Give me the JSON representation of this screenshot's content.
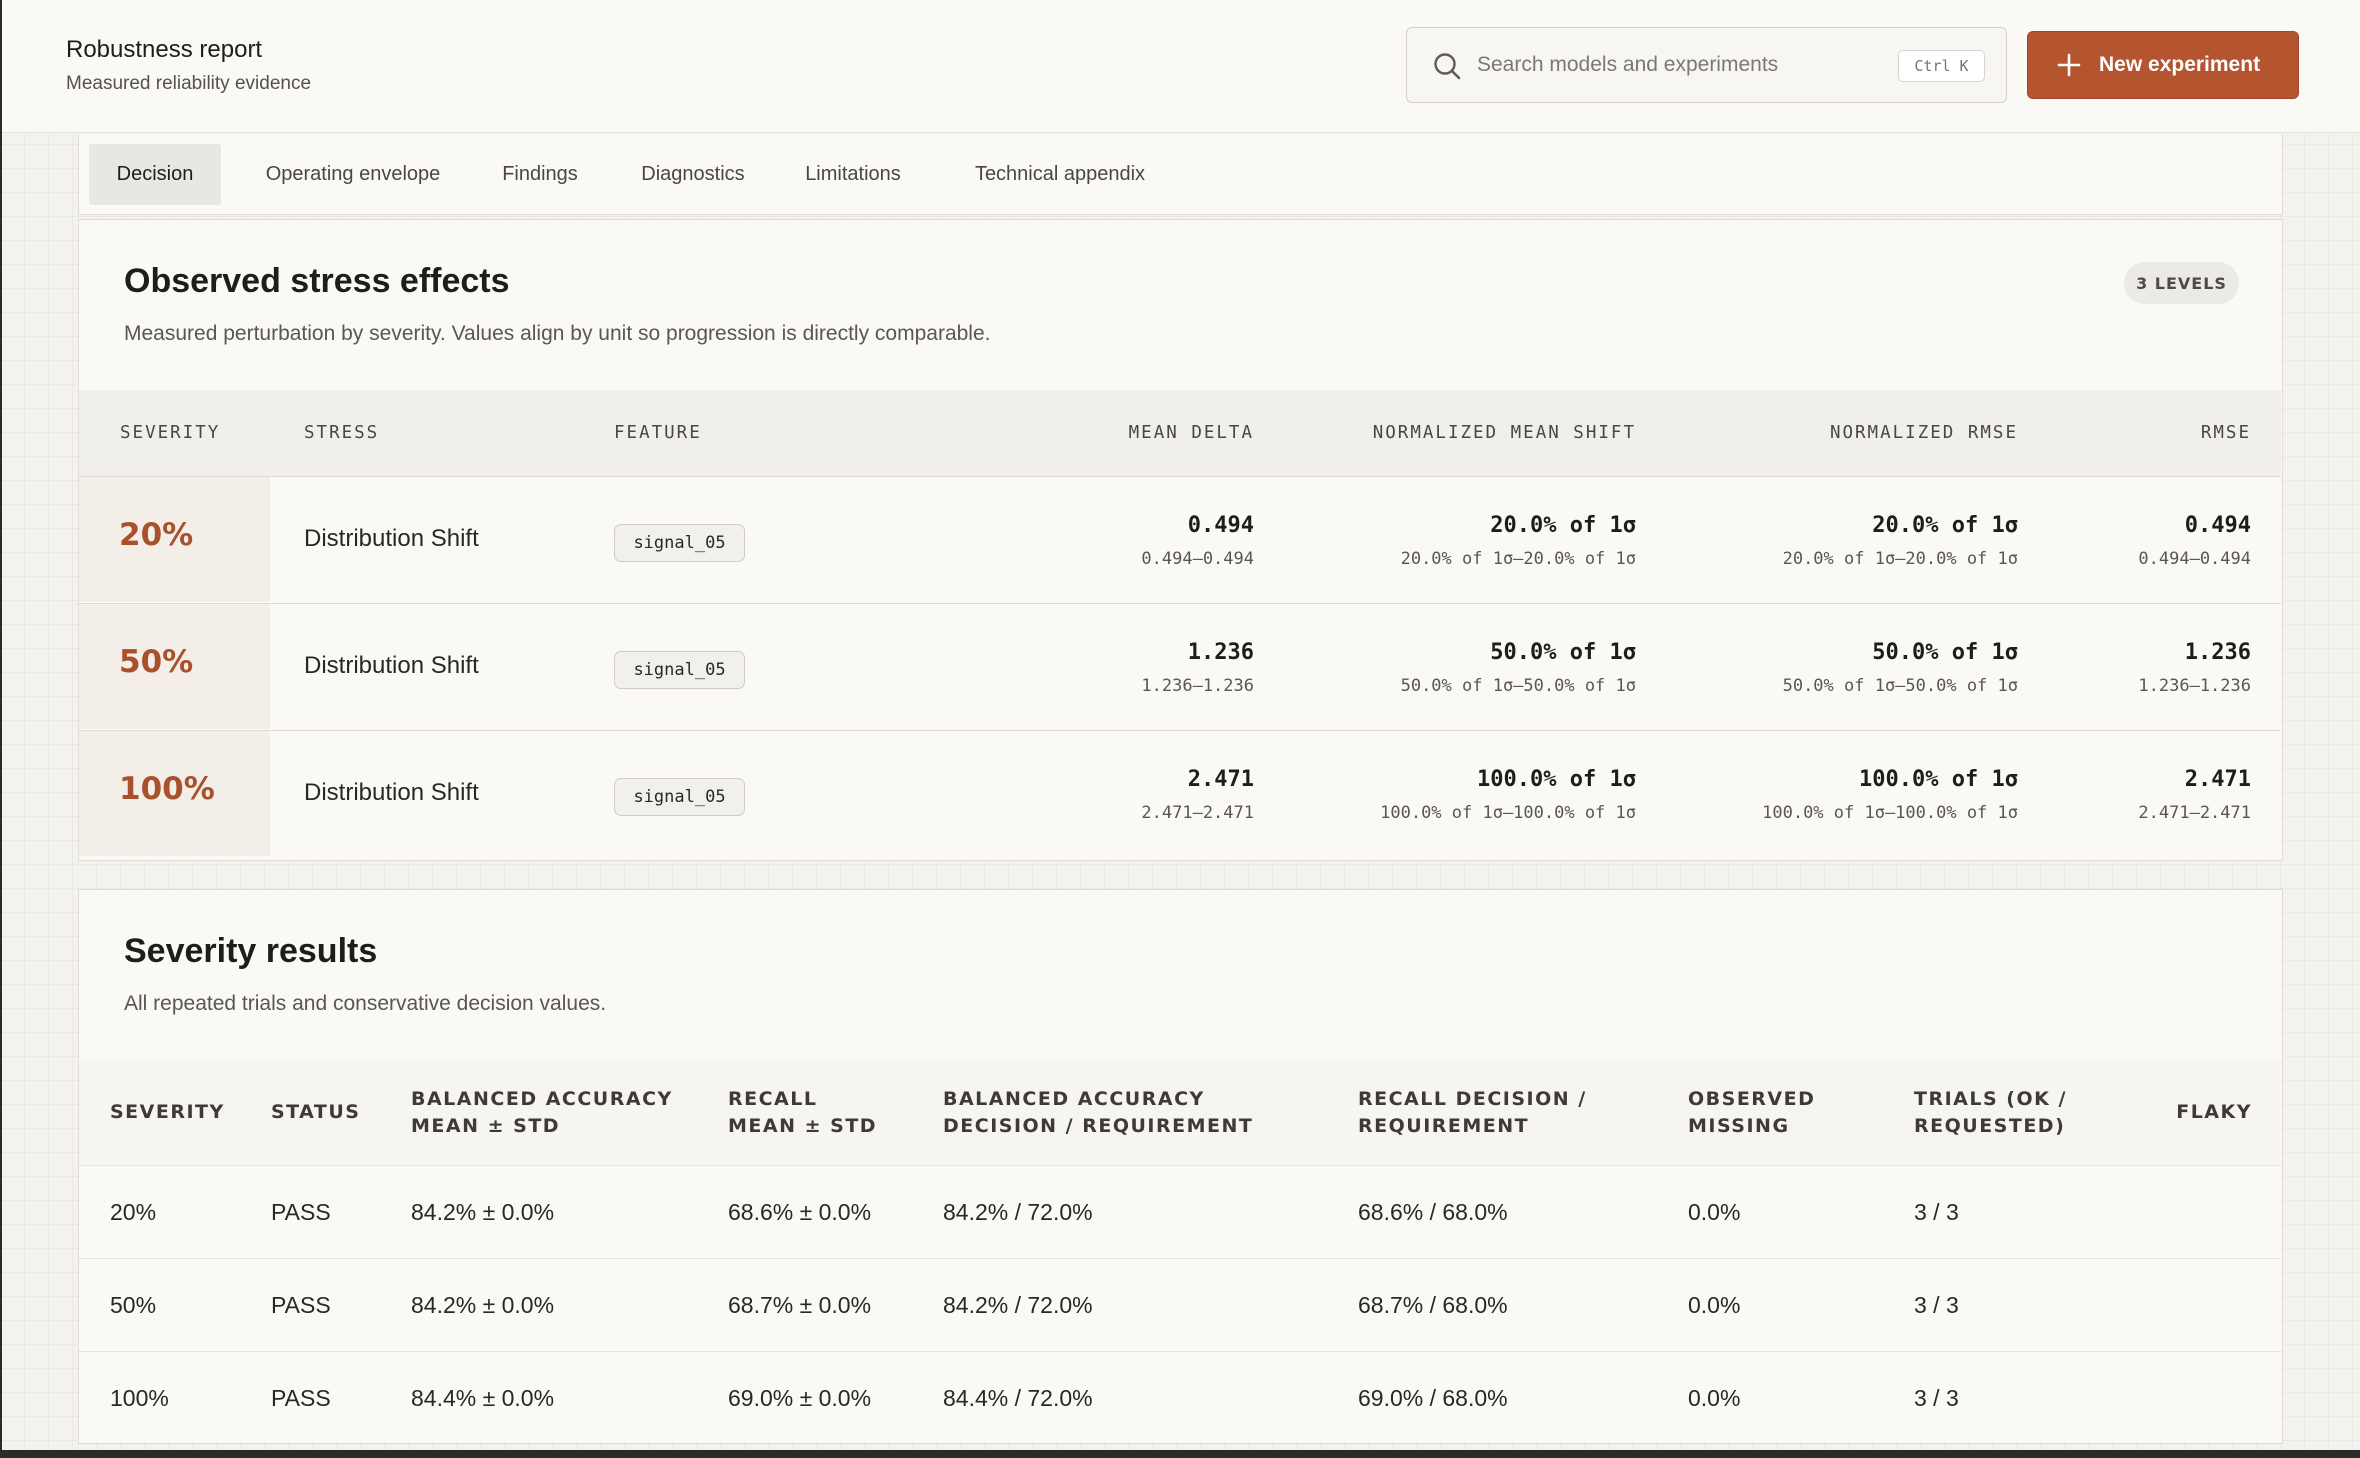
{
  "header": {
    "title": "Robustness report",
    "subtitle": "Measured reliability evidence",
    "search_placeholder": "Search models and experiments",
    "search_shortcut": "Ctrl K",
    "new_button_label": "New experiment"
  },
  "tabs": [
    {
      "label": "Decision",
      "active": true
    },
    {
      "label": "Operating envelope",
      "active": false
    },
    {
      "label": "Findings",
      "active": false
    },
    {
      "label": "Diagnostics",
      "active": false
    },
    {
      "label": "Limitations",
      "active": false
    },
    {
      "label": "Technical appendix",
      "active": false
    }
  ],
  "stress_effects": {
    "title": "Observed stress effects",
    "subtitle": "Measured perturbation by severity. Values align by unit so progression is directly comparable.",
    "badge": "3 LEVELS",
    "columns": {
      "severity": "Severity",
      "stress": "Stress",
      "feature": "Feature",
      "mean_delta": "Mean delta",
      "norm_mean_shift": "Normalized mean shift",
      "norm_rmse": "Normalized RMSE",
      "rmse": "RMSE"
    },
    "rows": [
      {
        "severity": "20%",
        "stress": "Distribution Shift",
        "feature": "signal_05",
        "mean_delta": "0.494",
        "mean_delta_range": "0.494–0.494",
        "norm_mean_shift": "20.0% of 1σ",
        "norm_mean_shift_range": "20.0% of 1σ–20.0% of 1σ",
        "norm_rmse": "20.0% of 1σ",
        "norm_rmse_range": "20.0% of 1σ–20.0% of 1σ",
        "rmse": "0.494",
        "rmse_range": "0.494–0.494"
      },
      {
        "severity": "50%",
        "stress": "Distribution Shift",
        "feature": "signal_05",
        "mean_delta": "1.236",
        "mean_delta_range": "1.236–1.236",
        "norm_mean_shift": "50.0% of 1σ",
        "norm_mean_shift_range": "50.0% of 1σ–50.0% of 1σ",
        "norm_rmse": "50.0% of 1σ",
        "norm_rmse_range": "50.0% of 1σ–50.0% of 1σ",
        "rmse": "1.236",
        "rmse_range": "1.236–1.236"
      },
      {
        "severity": "100%",
        "stress": "Distribution Shift",
        "feature": "signal_05",
        "mean_delta": "2.471",
        "mean_delta_range": "2.471–2.471",
        "norm_mean_shift": "100.0% of 1σ",
        "norm_mean_shift_range": "100.0% of 1σ–100.0% of 1σ",
        "norm_rmse": "100.0% of 1σ",
        "norm_rmse_range": "100.0% of 1σ–100.0% of 1σ",
        "rmse": "2.471",
        "rmse_range": "2.471–2.471"
      }
    ]
  },
  "severity_results": {
    "title": "Severity results",
    "subtitle": "All repeated trials and conservative decision values.",
    "columns": {
      "severity": "Severity",
      "status": "Status",
      "bal_acc": "Balanced accuracy mean ± std",
      "recall": "Recall mean ± std",
      "bal_acc_decision": "Balanced accuracy decision / requirement",
      "recall_decision": "Recall decision / requirement",
      "observed_missing": "Observed missing",
      "trials": "Trials (ok / requested)",
      "flaky": "Flaky"
    },
    "rows": [
      {
        "severity": "20%",
        "status": "PASS",
        "bal_acc": "84.2% ± 0.0%",
        "recall": "68.6% ± 0.0%",
        "bal_acc_decision": "84.2% / 72.0%",
        "recall_decision": "68.6% / 68.0%",
        "observed_missing": "0.0%",
        "trials": "3 / 3",
        "flaky": ""
      },
      {
        "severity": "50%",
        "status": "PASS",
        "bal_acc": "84.2% ± 0.0%",
        "recall": "68.7% ± 0.0%",
        "bal_acc_decision": "84.2% / 72.0%",
        "recall_decision": "68.7% / 68.0%",
        "observed_missing": "0.0%",
        "trials": "3 / 3",
        "flaky": ""
      },
      {
        "severity": "100%",
        "status": "PASS",
        "bal_acc": "84.4% ± 0.0%",
        "recall": "69.0% ± 0.0%",
        "bal_acc_decision": "84.4% / 72.0%",
        "recall_decision": "69.0% / 68.0%",
        "observed_missing": "0.0%",
        "trials": "3 / 3",
        "flaky": ""
      }
    ]
  },
  "colors": {
    "accent": "#b4552f",
    "severity_text": "#a9502c",
    "background": "#f3f2ed",
    "card": "#faf9f5"
  },
  "icons": {
    "search": "search-icon",
    "add": "plus-icon"
  }
}
